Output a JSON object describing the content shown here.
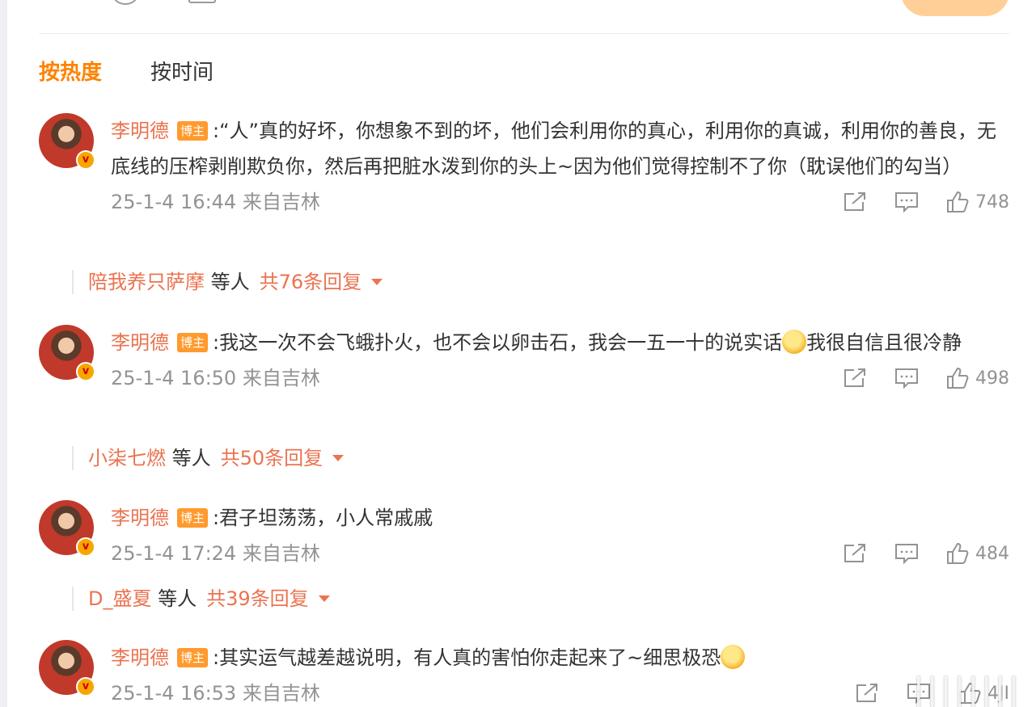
{
  "sort_tabs": [
    {
      "label": "按热度",
      "active": true
    },
    {
      "label": "按时间",
      "active": false
    }
  ],
  "comments": [
    {
      "username": "李明德",
      "badge": "博主",
      "text_before": ":“人”真的好坏，你想象不到的坏，他们会利用你的真心，利用你的真诚，利用你的善良，无底线的压榨剥削欺负你，然后再把脏水泼到你的头上~因为他们觉得控制不了你（耽误他们的勾当）",
      "emoji": "",
      "text_after": "",
      "time": "25-1-4 16:44 来自吉林",
      "likes": "748",
      "reply_users": "陪我养只萨摩",
      "reply_suffix": " 等人",
      "reply_count": "共76条回复"
    },
    {
      "username": "李明德",
      "badge": "博主",
      "text_before": ":我这一次不会飞蛾扑火，也不会以卵击石，我会一五一十的说实话",
      "emoji": "smile-emoji",
      "text_after": "我很自信且很冷静",
      "time": "25-1-4 16:50 来自吉林",
      "likes": "498",
      "reply_users": "小柒七燃",
      "reply_suffix": " 等人",
      "reply_count": "共50条回复"
    },
    {
      "username": "李明德",
      "badge": "博主",
      "text_before": ":君子坦荡荡，小人常戚戚",
      "emoji": "",
      "text_after": "",
      "time": "25-1-4 17:24 来自吉林",
      "likes": "484",
      "reply_users": "D_盛夏",
      "reply_suffix": " 等人",
      "reply_count": "共39条回复"
    },
    {
      "username": "李明德",
      "badge": "博主",
      "text_before": ":其实运气越差越说明，有人真的害怕你走起来了~细思极恐",
      "emoji": "hug-emoji",
      "text_after": "",
      "time": "25-1-4 16:53 来自吉林",
      "likes": "4JI",
      "reply_users": "",
      "reply_suffix": "",
      "reply_count": ""
    }
  ],
  "avatar_badge": "v",
  "watermark": "||||||||",
  "colors": {
    "accent": "#ff8200",
    "username": "#eb7350",
    "muted": "#939393",
    "badge": "#ff9a2e"
  }
}
